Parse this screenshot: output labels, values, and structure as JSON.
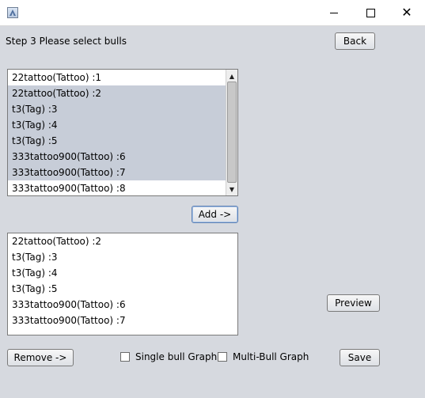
{
  "window": {
    "title": "",
    "icon": "java-app-icon",
    "controls": {
      "minimize_icon": "minimize-icon",
      "maximize_icon": "maximize-icon",
      "close_glyph": "✕"
    }
  },
  "step_label": "Step 3 Please select bulls",
  "buttons": {
    "back": "Back",
    "add": "Add ->",
    "preview": "Preview",
    "remove": "Remove ->",
    "save": "Save"
  },
  "available_list": {
    "items": [
      "22tattoo(Tattoo) :1",
      "22tattoo(Tattoo) :2",
      "t3(Tag) :3",
      "t3(Tag) :4",
      "t3(Tag) :5",
      "333tattoo900(Tattoo) :6",
      "333tattoo900(Tattoo) :7",
      "333tattoo900(Tattoo) :8"
    ],
    "selected_indices": [
      1,
      2,
      3,
      4,
      5,
      6
    ]
  },
  "selected_list": {
    "items": [
      "22tattoo(Tattoo) :2",
      "t3(Tag) :3",
      "t3(Tag) :4",
      "t3(Tag) :5",
      "333tattoo900(Tattoo) :6",
      "333tattoo900(Tattoo) :7"
    ]
  },
  "checkboxes": {
    "single_bull": {
      "label": "Single bull Graph",
      "checked": false
    },
    "multi_bull": {
      "label": "Multi-Bull Graph",
      "checked": false
    }
  },
  "colors": {
    "window_bg": "#d6d9df",
    "selection": "#c7cdd8",
    "focus_border": "#5b7fb3"
  }
}
